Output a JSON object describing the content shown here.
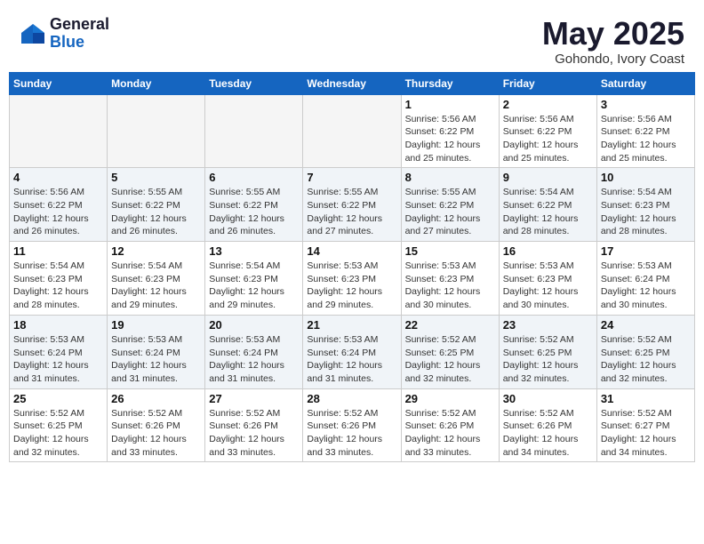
{
  "header": {
    "logo_general": "General",
    "logo_blue": "Blue",
    "month": "May 2025",
    "location": "Gohondo, Ivory Coast"
  },
  "weekdays": [
    "Sunday",
    "Monday",
    "Tuesday",
    "Wednesday",
    "Thursday",
    "Friday",
    "Saturday"
  ],
  "weeks": [
    [
      {
        "day": "",
        "info": ""
      },
      {
        "day": "",
        "info": ""
      },
      {
        "day": "",
        "info": ""
      },
      {
        "day": "",
        "info": ""
      },
      {
        "day": "1",
        "info": "Sunrise: 5:56 AM\nSunset: 6:22 PM\nDaylight: 12 hours\nand 25 minutes."
      },
      {
        "day": "2",
        "info": "Sunrise: 5:56 AM\nSunset: 6:22 PM\nDaylight: 12 hours\nand 25 minutes."
      },
      {
        "day": "3",
        "info": "Sunrise: 5:56 AM\nSunset: 6:22 PM\nDaylight: 12 hours\nand 25 minutes."
      }
    ],
    [
      {
        "day": "4",
        "info": "Sunrise: 5:56 AM\nSunset: 6:22 PM\nDaylight: 12 hours\nand 26 minutes."
      },
      {
        "day": "5",
        "info": "Sunrise: 5:55 AM\nSunset: 6:22 PM\nDaylight: 12 hours\nand 26 minutes."
      },
      {
        "day": "6",
        "info": "Sunrise: 5:55 AM\nSunset: 6:22 PM\nDaylight: 12 hours\nand 26 minutes."
      },
      {
        "day": "7",
        "info": "Sunrise: 5:55 AM\nSunset: 6:22 PM\nDaylight: 12 hours\nand 27 minutes."
      },
      {
        "day": "8",
        "info": "Sunrise: 5:55 AM\nSunset: 6:22 PM\nDaylight: 12 hours\nand 27 minutes."
      },
      {
        "day": "9",
        "info": "Sunrise: 5:54 AM\nSunset: 6:22 PM\nDaylight: 12 hours\nand 28 minutes."
      },
      {
        "day": "10",
        "info": "Sunrise: 5:54 AM\nSunset: 6:23 PM\nDaylight: 12 hours\nand 28 minutes."
      }
    ],
    [
      {
        "day": "11",
        "info": "Sunrise: 5:54 AM\nSunset: 6:23 PM\nDaylight: 12 hours\nand 28 minutes."
      },
      {
        "day": "12",
        "info": "Sunrise: 5:54 AM\nSunset: 6:23 PM\nDaylight: 12 hours\nand 29 minutes."
      },
      {
        "day": "13",
        "info": "Sunrise: 5:54 AM\nSunset: 6:23 PM\nDaylight: 12 hours\nand 29 minutes."
      },
      {
        "day": "14",
        "info": "Sunrise: 5:53 AM\nSunset: 6:23 PM\nDaylight: 12 hours\nand 29 minutes."
      },
      {
        "day": "15",
        "info": "Sunrise: 5:53 AM\nSunset: 6:23 PM\nDaylight: 12 hours\nand 30 minutes."
      },
      {
        "day": "16",
        "info": "Sunrise: 5:53 AM\nSunset: 6:23 PM\nDaylight: 12 hours\nand 30 minutes."
      },
      {
        "day": "17",
        "info": "Sunrise: 5:53 AM\nSunset: 6:24 PM\nDaylight: 12 hours\nand 30 minutes."
      }
    ],
    [
      {
        "day": "18",
        "info": "Sunrise: 5:53 AM\nSunset: 6:24 PM\nDaylight: 12 hours\nand 31 minutes."
      },
      {
        "day": "19",
        "info": "Sunrise: 5:53 AM\nSunset: 6:24 PM\nDaylight: 12 hours\nand 31 minutes."
      },
      {
        "day": "20",
        "info": "Sunrise: 5:53 AM\nSunset: 6:24 PM\nDaylight: 12 hours\nand 31 minutes."
      },
      {
        "day": "21",
        "info": "Sunrise: 5:53 AM\nSunset: 6:24 PM\nDaylight: 12 hours\nand 31 minutes."
      },
      {
        "day": "22",
        "info": "Sunrise: 5:52 AM\nSunset: 6:25 PM\nDaylight: 12 hours\nand 32 minutes."
      },
      {
        "day": "23",
        "info": "Sunrise: 5:52 AM\nSunset: 6:25 PM\nDaylight: 12 hours\nand 32 minutes."
      },
      {
        "day": "24",
        "info": "Sunrise: 5:52 AM\nSunset: 6:25 PM\nDaylight: 12 hours\nand 32 minutes."
      }
    ],
    [
      {
        "day": "25",
        "info": "Sunrise: 5:52 AM\nSunset: 6:25 PM\nDaylight: 12 hours\nand 32 minutes."
      },
      {
        "day": "26",
        "info": "Sunrise: 5:52 AM\nSunset: 6:26 PM\nDaylight: 12 hours\nand 33 minutes."
      },
      {
        "day": "27",
        "info": "Sunrise: 5:52 AM\nSunset: 6:26 PM\nDaylight: 12 hours\nand 33 minutes."
      },
      {
        "day": "28",
        "info": "Sunrise: 5:52 AM\nSunset: 6:26 PM\nDaylight: 12 hours\nand 33 minutes."
      },
      {
        "day": "29",
        "info": "Sunrise: 5:52 AM\nSunset: 6:26 PM\nDaylight: 12 hours\nand 33 minutes."
      },
      {
        "day": "30",
        "info": "Sunrise: 5:52 AM\nSunset: 6:26 PM\nDaylight: 12 hours\nand 34 minutes."
      },
      {
        "day": "31",
        "info": "Sunrise: 5:52 AM\nSunset: 6:27 PM\nDaylight: 12 hours\nand 34 minutes."
      }
    ]
  ]
}
